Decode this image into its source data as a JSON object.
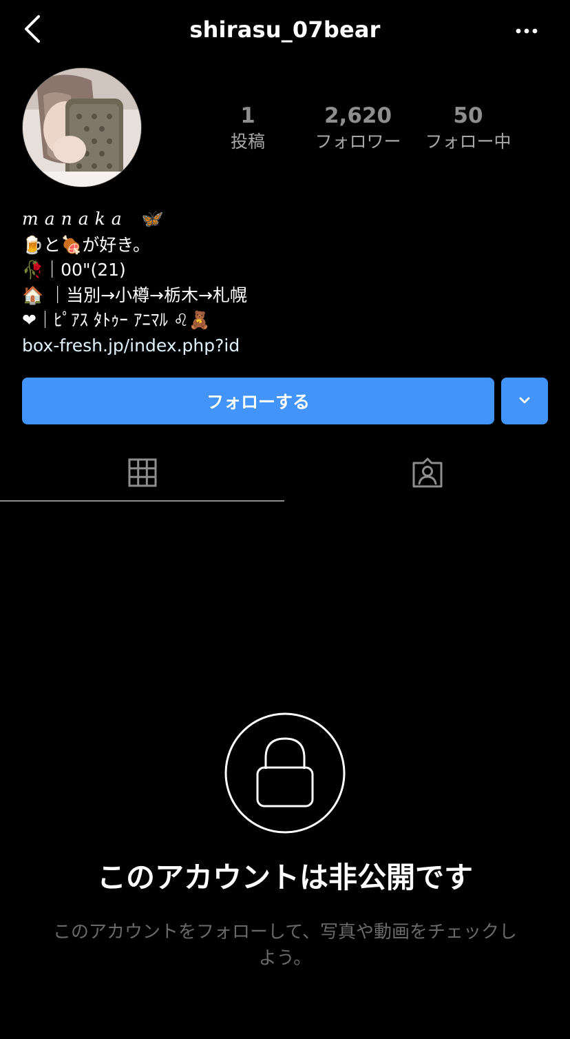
{
  "header": {
    "username": "shirasu_07bear",
    "back_icon": "chevron-left-icon",
    "more_icon": "more-horizontal-icon"
  },
  "stats": {
    "posts": {
      "count": "1",
      "label": "投稿"
    },
    "followers": {
      "count": "2,620",
      "label": "フォロワー"
    },
    "following": {
      "count": "50",
      "label": "フォロー中"
    }
  },
  "bio": {
    "name": "manaka 🦋",
    "line1": "🍺と🍖が好き。",
    "line2": "🥀｜00\"(21)",
    "line3": "🏠 ｜当別→小樽→栃木→札幌",
    "line4": "❤︎｜ﾋﾟｱｽ ﾀﾄｩｰ ｱﾆﾏﾙ ♌︎🧸",
    "link": "box-fresh.jp/index.php?id"
  },
  "actions": {
    "follow_label": "フォローする",
    "dropdown_icon": "chevron-down-icon",
    "accent_color": "#4394f8"
  },
  "tabs": {
    "grid_icon": "grid-icon",
    "tagged_icon": "tagged-person-icon"
  },
  "private": {
    "title": "このアカウントは非公開です",
    "subtitle": "このアカウントをフォローして、写真や動画をチェックしよう。",
    "icon": "lock-icon"
  }
}
